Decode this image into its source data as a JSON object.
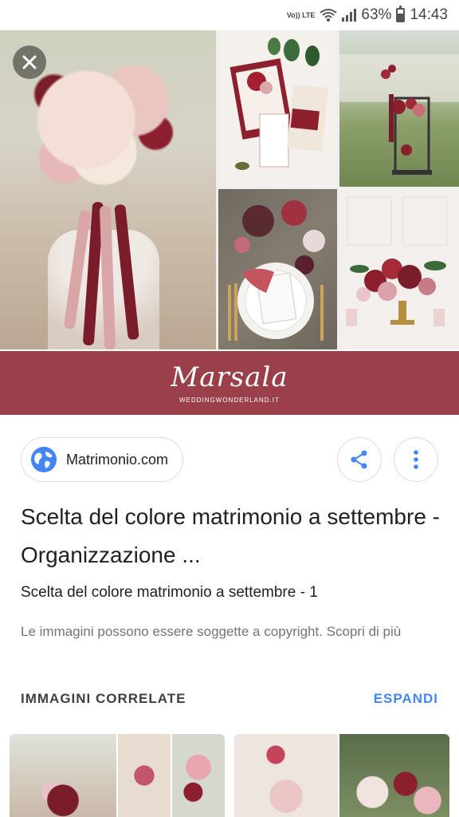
{
  "status_bar": {
    "network": "Vo)) LTE",
    "battery_percent": "63%",
    "battery_level": 0.63,
    "time": "14:43"
  },
  "hero": {
    "banner_title": "Marsala",
    "banner_subtitle": "WEDDINGWONDERLAND.IT",
    "colors": {
      "banner": "#9b3f4a",
      "burgundy": "#7b1c2a",
      "blush": "#d9a6a8"
    }
  },
  "source": {
    "name": "Matrimonio.com",
    "icon": "globe-icon"
  },
  "actions": {
    "share_icon": "share-icon",
    "more_icon": "more-vert-icon"
  },
  "result": {
    "title": "Scelta del colore matrimonio a settembre - Organizzazione ...",
    "subtitle": "Scelta del colore matrimonio a settembre - 1",
    "copyright_text": "Le immagini possono essere soggette a copyright.",
    "copyright_link": "Scopri di più"
  },
  "related": {
    "label": "IMMAGINI CORRELATE",
    "expand": "ESPANDI"
  },
  "accent_color": "#4285f4"
}
